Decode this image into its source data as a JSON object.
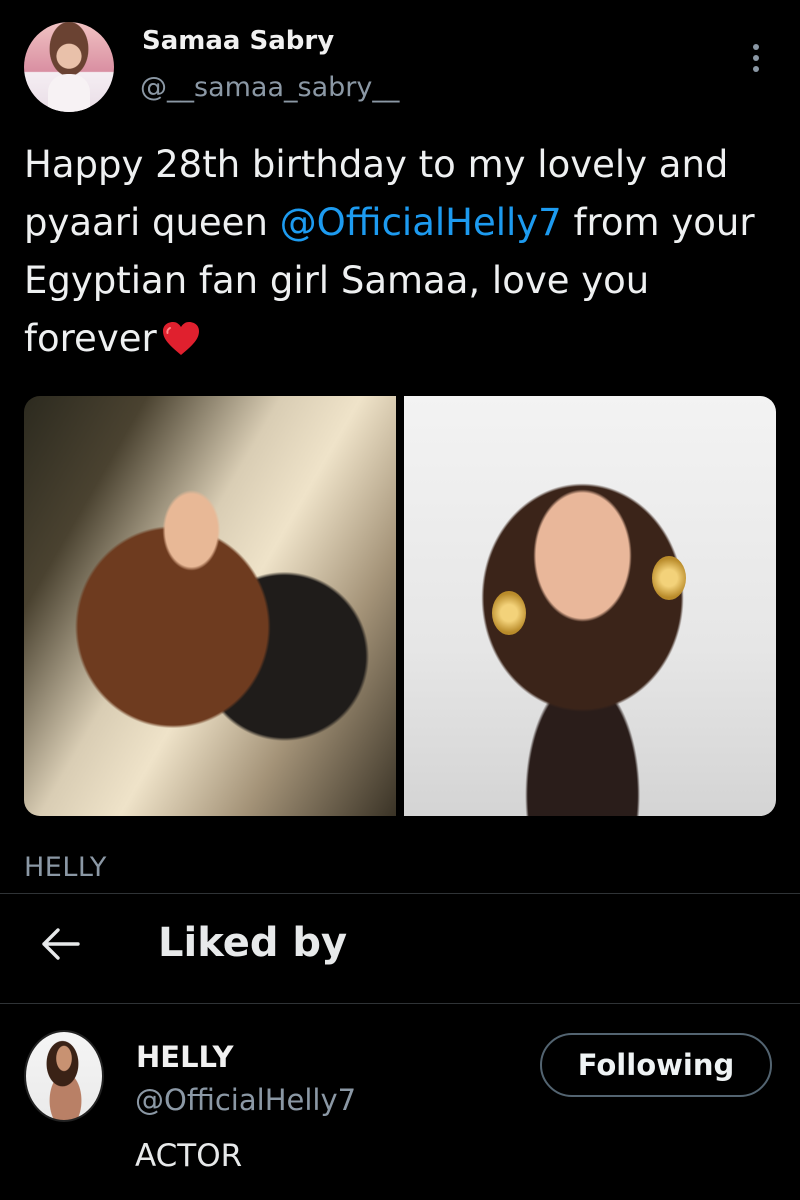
{
  "tweet": {
    "author_name": "Samaa Sabry",
    "author_handle": "@__samaa_sabry__",
    "text_before_mention": "Happy 28th birthday to my lovely and pyaari queen ",
    "mention": "@OfficialHelly7",
    "text_after_mention": " from your Egyptian fan girl Samaa, love you forever",
    "emoji_icon": "red-heart-icon",
    "more_icon": "more-vertical-icon"
  },
  "media_caption": "HELLY",
  "liked_by": {
    "title": "Liked by",
    "back_icon": "arrow-left-icon",
    "users": [
      {
        "name": "HELLY",
        "handle": "@OfficialHelly7",
        "bio": "ACTOR",
        "button_label": "Following"
      }
    ]
  },
  "colors": {
    "background": "#000000",
    "text": "#e7e9ea",
    "secondary_text": "#8b98a5",
    "link": "#1d9bf0",
    "divider": "#2f3336",
    "heart": "#e0202e"
  }
}
